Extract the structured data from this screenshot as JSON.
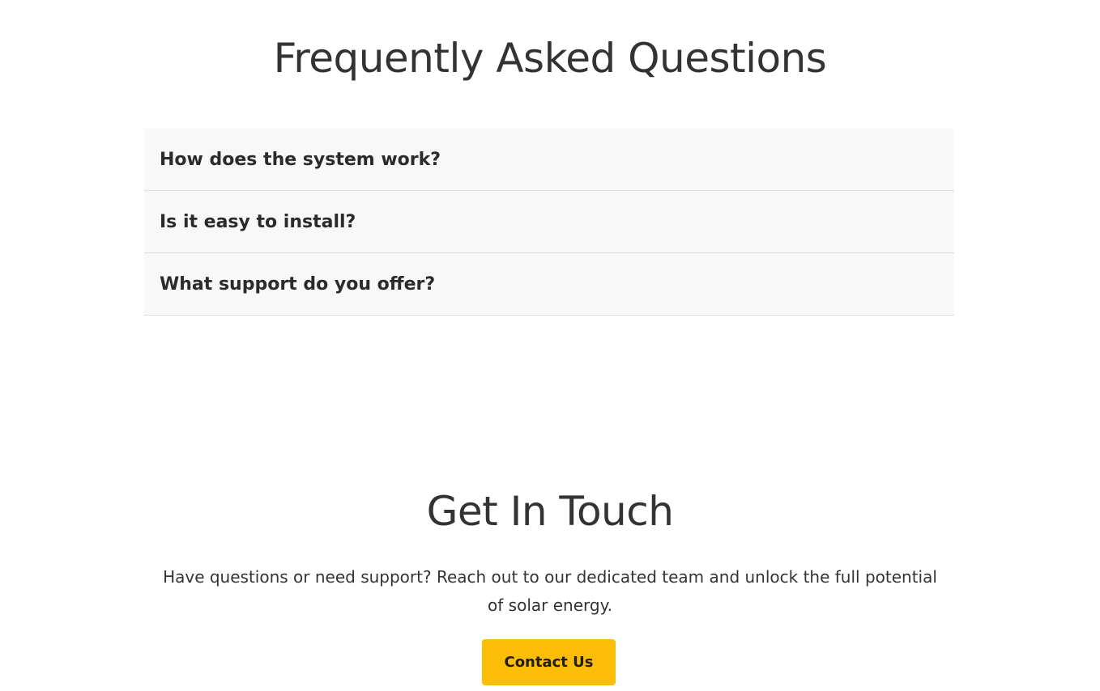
{
  "faq": {
    "title": "Frequently Asked Questions",
    "items": [
      {
        "question": "How does the system work?"
      },
      {
        "question": "Is it easy to install?"
      },
      {
        "question": "What support do you offer?"
      }
    ]
  },
  "contact": {
    "title": "Get In Touch",
    "text": "Have questions or need support? Reach out to our dedicated team and unlock the full potential of solar energy.",
    "button_label": "Contact Us"
  },
  "colors": {
    "accent": "#fbbd08",
    "faq_background": "#f8f8f8",
    "text": "#333333"
  }
}
